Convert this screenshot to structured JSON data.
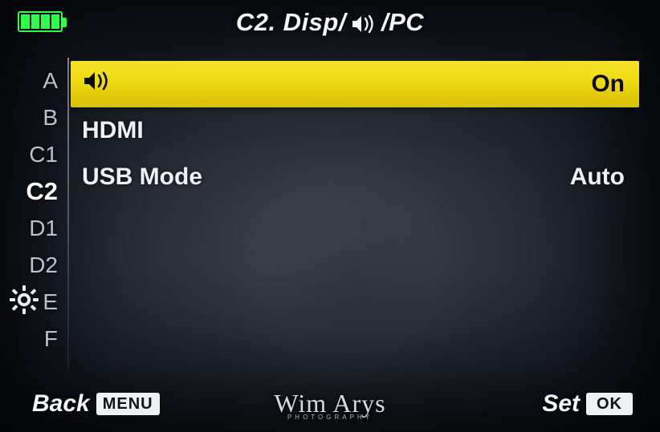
{
  "header": {
    "title_prefix": "C2. Disp/",
    "title_suffix": "/PC"
  },
  "battery": {
    "level_cells": 4
  },
  "sidebar": {
    "tabs": [
      {
        "label": "A",
        "active": false
      },
      {
        "label": "B",
        "active": false
      },
      {
        "label": "C1",
        "active": false
      },
      {
        "label": "C2",
        "active": true
      },
      {
        "label": "D1",
        "active": false
      },
      {
        "label": "D2",
        "active": false
      },
      {
        "label": "E",
        "active": false
      },
      {
        "label": "F",
        "active": false
      }
    ]
  },
  "menu": {
    "rows": [
      {
        "kind": "beep",
        "value": "On",
        "selected": true
      },
      {
        "kind": "text",
        "label": "HDMI",
        "value": "",
        "selected": false
      },
      {
        "kind": "text",
        "label": "USB Mode",
        "value": "Auto",
        "selected": false
      }
    ]
  },
  "footer": {
    "back_label": "Back",
    "back_key": "MENU",
    "set_label": "Set",
    "set_key": "OK"
  },
  "watermark": {
    "text": "Wim Arys",
    "sub": "PHOTOGRAPHY"
  },
  "colors": {
    "highlight": "#f0dc12",
    "battery": "#2eff4a"
  }
}
